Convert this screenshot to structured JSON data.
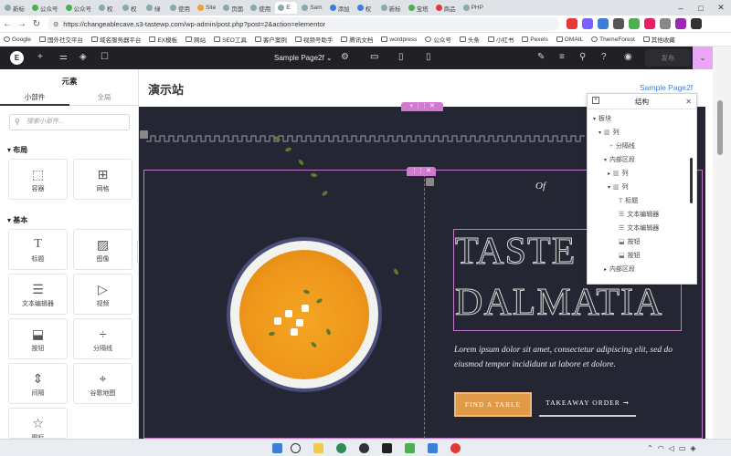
{
  "browser": {
    "tabs": [
      "新标",
      "公众号",
      "公众号",
      "权",
      "权",
      "绿",
      "使用",
      "Site",
      "页面",
      "使用",
      "E",
      "Sam",
      "添加",
      "权",
      "新标",
      "宝塔",
      "商品",
      "PHP"
    ],
    "url": "https://changeablecave.s3-tastewp.com/wp-admin/post.php?post=2&action=elementor",
    "bookmarks": [
      "Google",
      "国外社交平台",
      "域名服务器平台",
      "EX模板",
      "网站",
      "SEO工具",
      "客户案例",
      "视频号助手",
      "腾讯文档",
      "wordpress",
      "公众号",
      "头条",
      "小红书",
      "Pexels",
      "GMAIL",
      "ThemeForest",
      "其他收藏"
    ]
  },
  "editor": {
    "page_name": "Sample Page2f",
    "publish_label": "发布"
  },
  "panel": {
    "title": "元素",
    "tab_widgets": "小部件",
    "tab_global": "全局",
    "search_placeholder": "搜索小部件...",
    "section_layout": "布局",
    "section_basic": "基本",
    "widgets": {
      "container": "容器",
      "grid": "网格",
      "heading": "标题",
      "image": "图像",
      "text_editor": "文本编辑器",
      "video": "视频",
      "button": "按钮",
      "divider": "分隔线",
      "spacer": "间隔",
      "map": "谷歌地图",
      "icon": "图标"
    }
  },
  "page": {
    "site_title": "演示站",
    "page_title": "Sample Page2f",
    "of_text": "Of",
    "title_line1": "TASTE",
    "title_line2": "DALMATIA",
    "lorem": "Lorem ipsum dolor sit amet, consectetur adipiscing elit, sed do eiusmod tempor incididunt ut labore et dolore.",
    "btn_find": "FIND A TABLE",
    "btn_take": "TAKEAWAY ORDER ➞"
  },
  "navigator": {
    "title": "结构",
    "items": {
      "block": "板块",
      "col1": "列",
      "divider": "分隔线",
      "inner1": "内部区段",
      "col2": "列",
      "col3": "列",
      "heading": "标题",
      "text1": "文本编辑器",
      "text2": "文本编辑器",
      "btn1": "按钮",
      "btn2": "按钮",
      "inner2": "内部区段"
    }
  },
  "colors": {
    "hero_bg": "#252633",
    "accent_button": "#e09a48",
    "editor_bar": "#1f2124",
    "selection": "#c27ac9"
  }
}
